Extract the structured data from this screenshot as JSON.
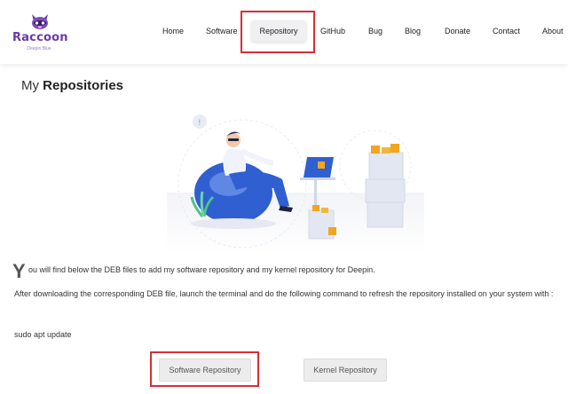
{
  "header": {
    "logo": {
      "name": "Raccoon",
      "tagline": "Deepin Blue",
      "icon": "raccoon-logo"
    },
    "nav": [
      {
        "label": "Home"
      },
      {
        "label": "Software"
      },
      {
        "label": "Repository",
        "active": true
      },
      {
        "label": "GitHub"
      },
      {
        "label": "Bug"
      },
      {
        "label": "Blog"
      },
      {
        "label": "Donate"
      },
      {
        "label": "Contact"
      },
      {
        "label": "About"
      }
    ]
  },
  "page": {
    "title_prefix": "My",
    "title_bold": "Repositories",
    "dropcap": "Y",
    "intro": "ou will find below the DEB files to add my software repository and my kernel repository for Deepin.",
    "instructions": "After downloading the corresponding DEB file, launch the terminal and do the following command to refresh the repository installed on your system with :",
    "command": "sudo apt update"
  },
  "buttons": {
    "software": "Software Repository",
    "kernel": "Kernel Repository"
  },
  "colors": {
    "brand": "#6a3aa8",
    "highlight": "#d32f3a",
    "illustration_blue": "#2f5fd0"
  }
}
